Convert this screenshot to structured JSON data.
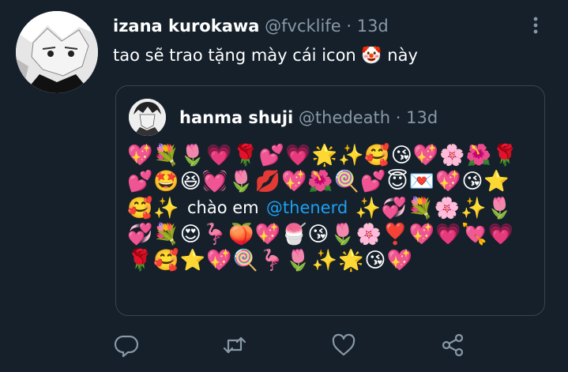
{
  "tweet": {
    "author_name": "izana kurokawa",
    "author_handle": "@fvcklife",
    "separator": "·",
    "time_ago": "13d",
    "text_before": "tao sẽ trao tặng mày cái icon",
    "emoji": "🤡",
    "text_after": "này"
  },
  "quoted_tweet": {
    "author_name": "hanma shuji",
    "author_handle": "@thedeath",
    "separator": "·",
    "time_ago": "13d",
    "emoji_line_1": "💖💐🌷💗🌹💕💗🌟✨🥰😘💖🌸🌺🌹💕🤩😆💓🌷💋💖🌺🍭💕😇💌💖😘⭐🥰✨",
    "inline_text": "chào em",
    "mention": "@thenerd",
    "emoji_line_2": "✨💞💐🌸✨🌷💞💐😍🦩🍑💖🍧😘🌷🌸❣️💖💗💘💗🌹🥰⭐💖🍭🦩🌷✨🌟😘💖"
  },
  "icons": {
    "more": "more-vertical-icon",
    "reply": "reply-icon",
    "retweet": "retweet-icon",
    "like": "heart-icon",
    "share": "share-icon"
  },
  "colors": {
    "background": "#15202b",
    "secondary_text": "#8899a6",
    "link": "#1da1f2",
    "border": "#38444d"
  }
}
